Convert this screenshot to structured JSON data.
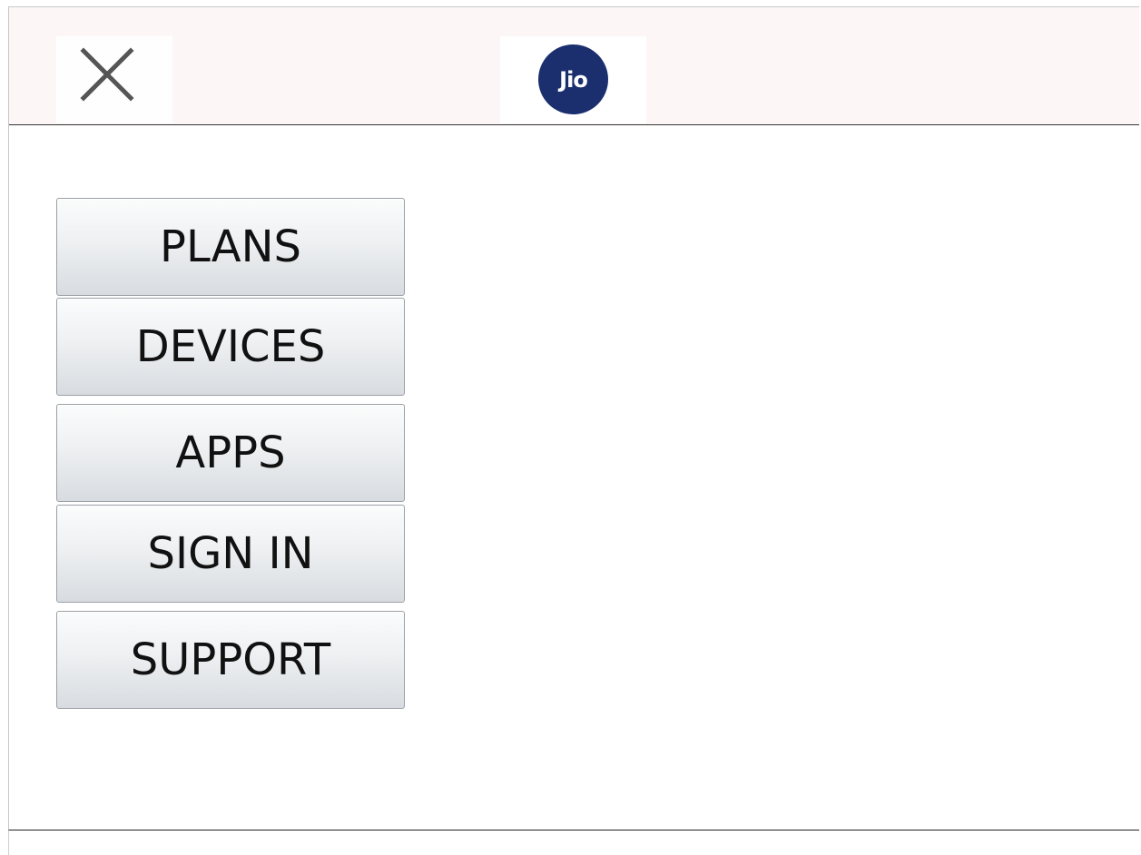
{
  "header": {
    "close_icon": "close-icon",
    "logo_text": "Jio",
    "background_color": "#fdf6f6",
    "logo_color": "#1b2f6e"
  },
  "menu": {
    "items": [
      {
        "label": "PLANS"
      },
      {
        "label": "DEVICES"
      },
      {
        "label": "APPS"
      },
      {
        "label": "SIGN IN"
      },
      {
        "label": "SUPPORT"
      }
    ]
  }
}
